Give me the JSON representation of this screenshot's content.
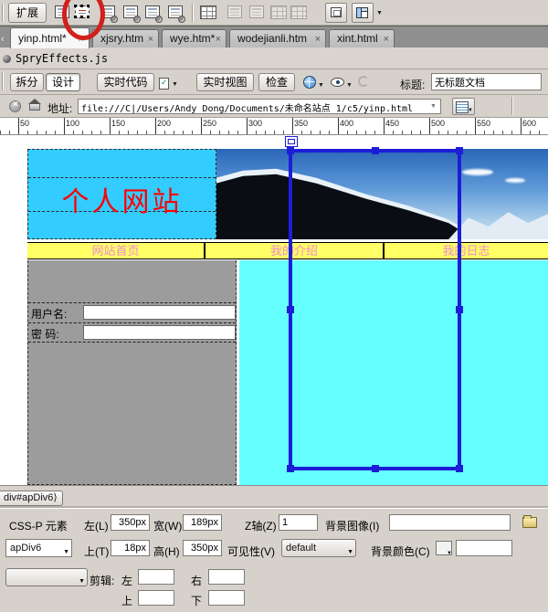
{
  "ui": {
    "close_glyph": "×",
    "dropdown_glyph": "▼",
    "tab_scroll_left": "‹",
    "tag_bracket": "⟩"
  },
  "insert_bar": {
    "extend_label": "扩展",
    "icons": [
      "insert-div-tag",
      "draw-ap-div",
      "spry-menu-bar",
      "spry-tabbed-panels",
      "spry-accordion",
      "spry-collapsible-panel",
      "table",
      "insert-row-above",
      "insert-row-below",
      "insert-column-left",
      "insert-column-right",
      "iframe",
      "frames"
    ]
  },
  "tabs": {
    "items": [
      {
        "label": "yinp.html*",
        "active": true
      },
      {
        "label": "xjsry.htm",
        "active": false
      },
      {
        "label": "wye.htm*",
        "active": false
      },
      {
        "label": "wodejianli.htm",
        "active": false
      },
      {
        "label": "xint.html",
        "active": false
      }
    ]
  },
  "related_files": {
    "file": "SpryEffects.js"
  },
  "doc_toolbar": {
    "split": "拆分",
    "design": "设计",
    "live_code": "实时代码",
    "live_view": "实时视图",
    "inspect": "检查",
    "title_label": "标题:",
    "title_value": "无标题文档"
  },
  "address_bar": {
    "label": "地址:",
    "value": "file:///C|/Users/Andy Dong/Documents/未命名站点 1/c5/yinp.html"
  },
  "ruler": {
    "labels": [
      50,
      100,
      150,
      200,
      250,
      300,
      350,
      400,
      450,
      500,
      550,
      600
    ]
  },
  "page": {
    "site_title": "个人网站",
    "nav_items": [
      "网站首页",
      "我的介绍",
      "我的日志"
    ],
    "login": {
      "username_label": "用户名:",
      "password_label": "密 码:"
    }
  },
  "tag_selector": {
    "tag": "div#apDiv6"
  },
  "properties": {
    "element_type": "CSS-P 元素",
    "id_value": "apDiv6",
    "left_label": "左(L)",
    "left_value": "350px",
    "width_label": "宽(W)",
    "width_value": "189px",
    "top_label": "上(T)",
    "top_value": "18px",
    "height_label": "高(H)",
    "height_value": "350px",
    "z_label": "Z轴(Z)",
    "z_value": "1",
    "visibility_label": "可见性(V)",
    "visibility_value": "default",
    "bg_image_label": "背景图像(I)",
    "bg_image_value": "",
    "bg_color_label": "背景颜色(C)",
    "bg_color_value": "",
    "clip_label": "剪辑:",
    "clip_left_label": "左",
    "clip_right_label": "右",
    "clip_top_label": "上",
    "clip_bottom_label": "下"
  },
  "colors": {
    "header_cyan": "#33ccff",
    "content_cyan": "#66ffff",
    "nav_yellow": "#ffff66",
    "nav_text_pink": "#ee8cd0",
    "site_title_red": "#ff0000",
    "selection_blue": "#1d1dd8",
    "sidebar_gray": "#9c9c9c",
    "annotation_red": "#d2201c"
  }
}
